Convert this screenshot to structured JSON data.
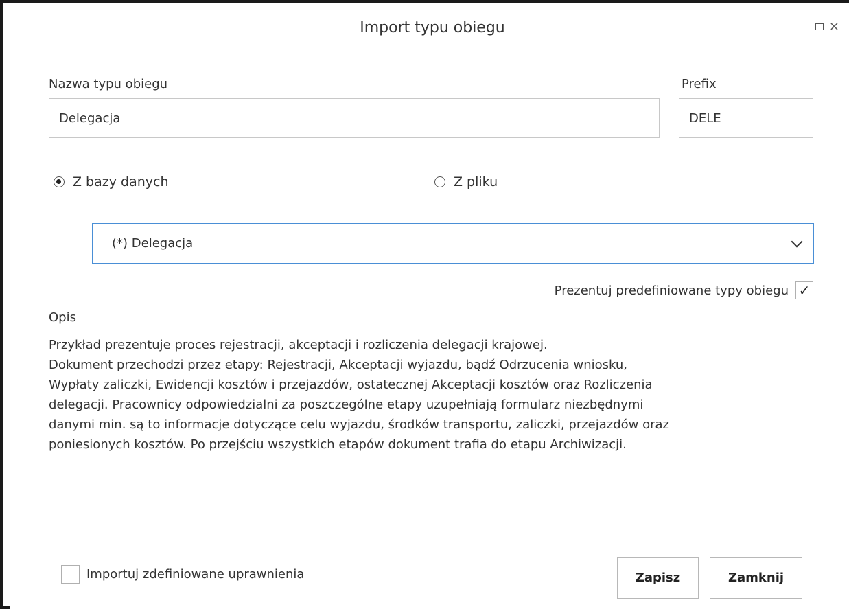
{
  "dialog": {
    "title": "Import typu obiegu"
  },
  "form": {
    "name_label": "Nazwa typu obiegu",
    "name_value": "Delegacja",
    "prefix_label": "Prefix",
    "prefix_value": "DELE"
  },
  "source": {
    "option_db_label": "Z bazy danych",
    "option_db_checked": true,
    "option_file_label": "Z pliku",
    "option_file_checked": false,
    "selected_value": "(*) Delegacja"
  },
  "predefined": {
    "label": "Prezentuj predefiniowane typy obiegu",
    "checked": true,
    "check_glyph": "✓"
  },
  "description": {
    "label": "Opis",
    "lines": [
      "Przykład prezentuje proces rejestracji, akceptacji i rozliczenia delegacji krajowej.",
      "Dokument przechodzi przez etapy: Rejestracji, Akceptacji wyjazdu, bądź Odrzucenia wniosku,",
      "Wypłaty zaliczki, Ewidencji kosztów i przejazdów, ostatecznej Akceptacji kosztów oraz Rozliczenia",
      "delegacji. Pracownicy odpowiedzialni za poszczególne etapy uzupełniają formularz niezbędnymi",
      "danymi min. są to informacje dotyczące celu wyjazdu, środków transportu, zaliczki, przejazdów oraz",
      "poniesionych kosztów. Po przejściu wszystkich etapów dokument trafia do etapu Archiwizacji."
    ]
  },
  "footer": {
    "import_permissions_label": "Importuj zdefiniowane uprawnienia",
    "import_permissions_checked": false,
    "save_label": "Zapisz",
    "close_label": "Zamknij"
  },
  "window_controls": {
    "close_glyph": "×"
  },
  "icons": {
    "maximize": "maximize-icon",
    "close": "close-icon",
    "dropdown": "chevron-down-icon",
    "check": "checkmark-icon"
  }
}
